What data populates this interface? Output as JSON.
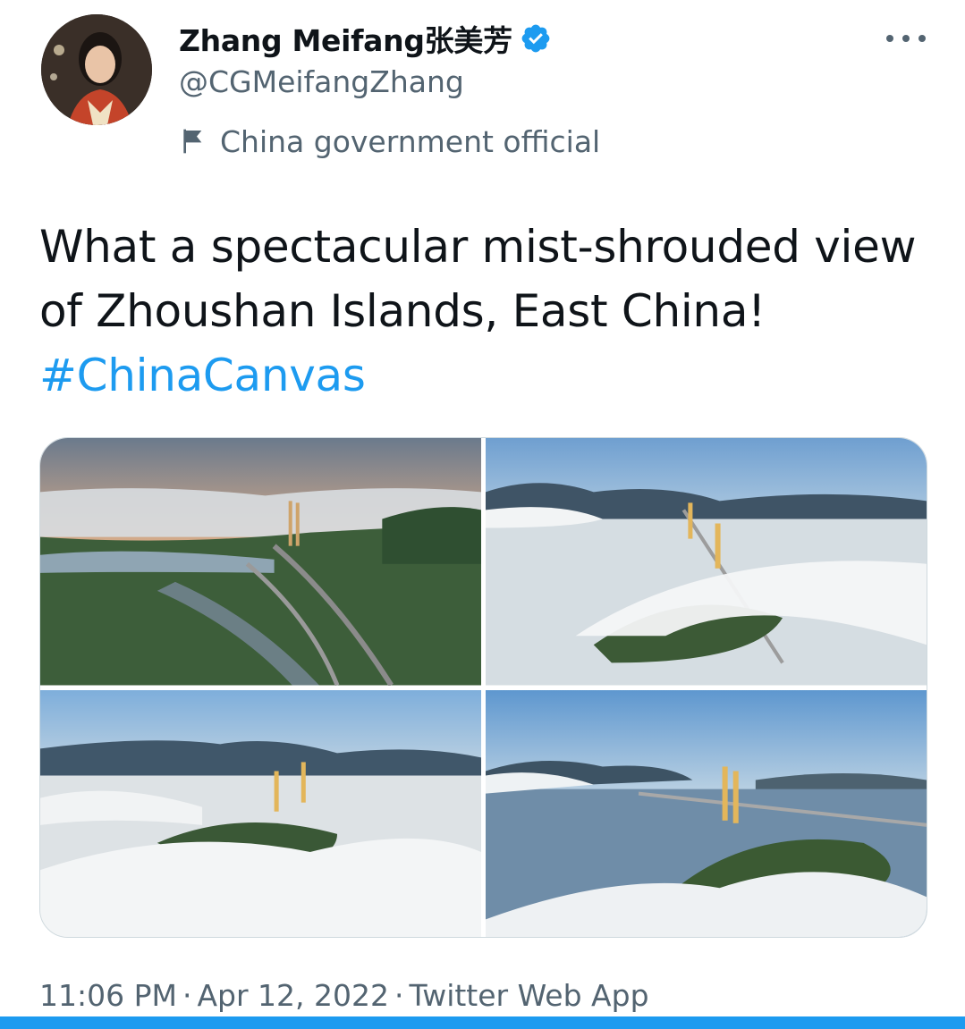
{
  "author": {
    "display_name": "Zhang Meifang张美芳",
    "handle": "@CGMeifangZhang",
    "label": "China government official",
    "verified": true
  },
  "tweet": {
    "text": "What a spectacular mist-shrouded view of Zhoushan Islands, East China! ",
    "hashtag": "#ChinaCanvas"
  },
  "media": {
    "photos": [
      {
        "subject": "coastal highway interchange at sunset with fog bank and suspension bridge"
      },
      {
        "subject": "suspension bridge emerging from sea of clouds over island"
      },
      {
        "subject": "bridge towers above thick fog with mountains behind"
      },
      {
        "subject": "suspension bridge across strait with fog-covered island"
      }
    ]
  },
  "footer": {
    "time": "11:06 PM",
    "date": "Apr 12, 2022",
    "source": "Twitter Web App",
    "separator": "·"
  },
  "icons": {
    "verified": "verified-badge-icon",
    "label": "flag-icon",
    "more": "more-options-icon"
  },
  "colors": {
    "accent": "#1d9bf0",
    "secondary_text": "#536471",
    "primary_text": "#0f1419"
  }
}
